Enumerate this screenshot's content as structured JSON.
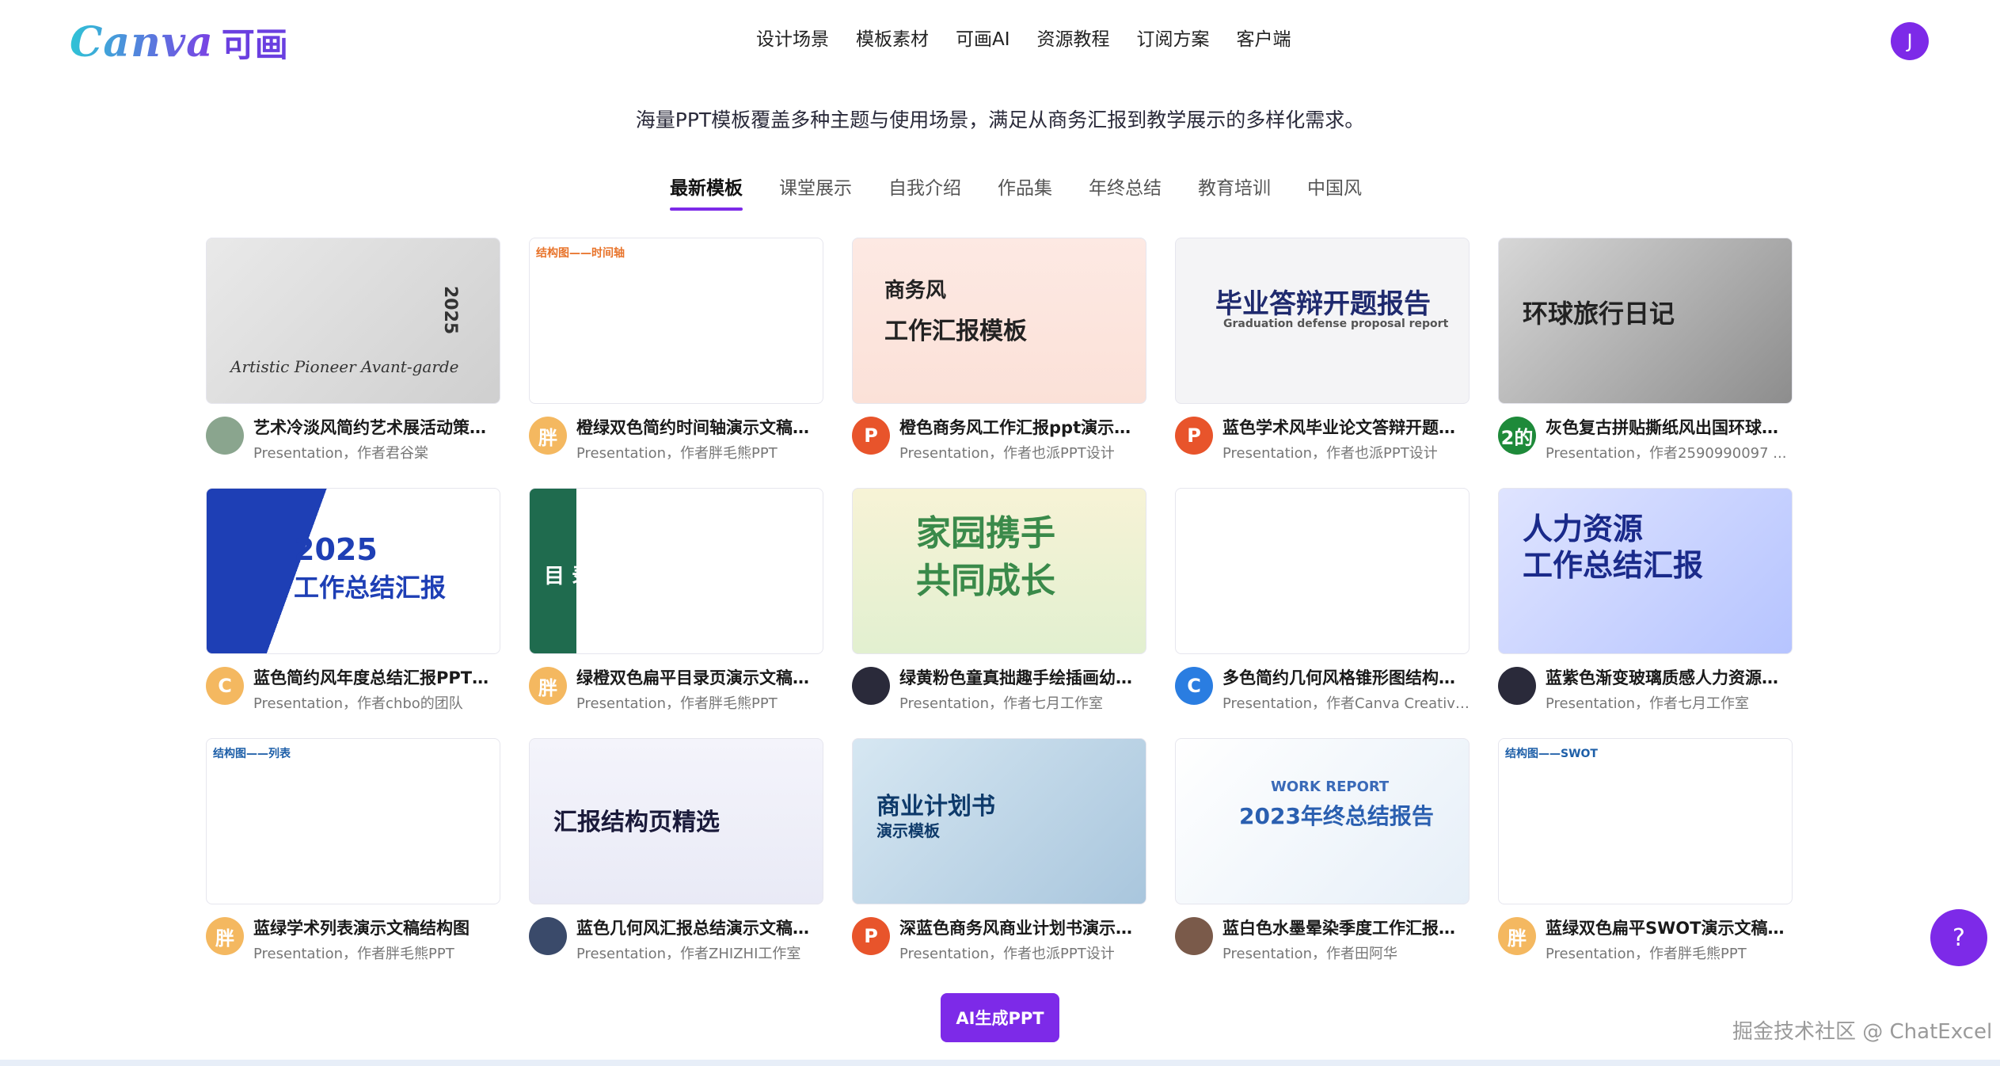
{
  "brand": {
    "word": "Canva",
    "cn": "可画"
  },
  "nav": [
    "设计场景",
    "模板素材",
    "可画AI",
    "资源教程",
    "订阅方案",
    "客户端"
  ],
  "user_initial": "J",
  "subtitle": "海量PPT模板覆盖多种主题与使用场景，满足从商务汇报到教学展示的多样化需求。",
  "tabs": [
    "最新模板",
    "课堂展示",
    "自我介绍",
    "作品集",
    "年终总结",
    "教育培训",
    "中国风"
  ],
  "active_tab": 0,
  "cards": [
    {
      "title": "艺术冷淡风简约艺术展活动策划...",
      "author": "Presentation，作者君谷棠",
      "av": "",
      "avbg": "#8aa58e",
      "thumb": {
        "bg": "linear-gradient(135deg,#e9e9e9,#cfcfcf)",
        "t1": "Artistic Pioneer  Avant-garde",
        "t1c": "#333",
        "t2": "2025",
        "t2c": "#333"
      }
    },
    {
      "title": "橙绿双色简约时间轴演示文稿结...",
      "author": "Presentation，作者胖毛熊PPT",
      "av": "胖",
      "avbg": "#f4b860",
      "thumb": {
        "bg": "#ffffff",
        "t1": "结构图——时间轴",
        "t1c": "#e8742b",
        "t2": "",
        "t2c": "#2a9d8f"
      }
    },
    {
      "title": "橙色商务风工作汇报ppt演示文稿",
      "author": "Presentation，作者也派PPT设计",
      "av": "P",
      "avbg": "#e8542b",
      "thumb": {
        "bg": "linear-gradient(180deg,#fde9e3,#fbe1d8)",
        "t1": "商务风",
        "t1c": "#222",
        "t2": "工作汇报模板",
        "t2c": "#222"
      }
    },
    {
      "title": "蓝色学术风毕业论文答辩开题报...",
      "author": "Presentation，作者也派PPT设计",
      "av": "P",
      "avbg": "#e8542b",
      "thumb": {
        "bg": "#f4f4f6",
        "t1": "毕业答辩开题报告",
        "t1c": "#1f2a6e",
        "t2": "Graduation defense proposal report",
        "t2c": "#555"
      }
    },
    {
      "title": "灰色复古拼贴撕纸风出国环球旅...",
      "author": "Presentation，作者2590990097 ...",
      "av": "2的",
      "avbg": "#1e8a3a",
      "thumb": {
        "bg": "linear-gradient(135deg,#d7d7d7,#8d8d8d)",
        "t1": "环球旅行日记",
        "t1c": "#222",
        "t2": "",
        "t2c": "#222"
      }
    },
    {
      "title": "蓝色简约风年度总结汇报PPT演...",
      "author": "Presentation，作者chbo的团队",
      "av": "C",
      "avbg": "#f4b860",
      "thumb": {
        "bg": "linear-gradient(110deg,#1e3fb5 0 34%,#ffffff 34%)",
        "t1": "2025",
        "t1c": "#1e3fb5",
        "t2": "工作总结汇报",
        "t2c": "#1e3fb5"
      }
    },
    {
      "title": "绿橙双色扁平目录页演示文稿结...",
      "author": "Presentation，作者胖毛熊PPT",
      "av": "胖",
      "avbg": "#f4b860",
      "thumb": {
        "bg": "linear-gradient(90deg,#1f6b4e 0 16%,#ffffff 16%)",
        "t1": "目 录",
        "t1c": "#ffffff",
        "t2": "",
        "t2c": "#e8942b"
      }
    },
    {
      "title": "绿黄粉色童真拙趣手绘插画幼儿...",
      "author": "Presentation，作者七月工作室",
      "av": "",
      "avbg": "#2a2a3a",
      "thumb": {
        "bg": "linear-gradient(180deg,#f7f3d6,#e2f0d0)",
        "t1": "家园携手",
        "t1c": "#3a8a4a",
        "t2": "共同成长",
        "t2c": "#3a8a4a"
      }
    },
    {
      "title": "多色简约几何风格锥形图结构图...",
      "author": "Presentation，作者Canva Creative...",
      "av": "C",
      "avbg": "#2a7de1",
      "thumb": {
        "bg": "#ffffff",
        "t1": "",
        "t1c": "#7b5be4",
        "t2": "",
        "t2c": "#7b5be4"
      }
    },
    {
      "title": "蓝紫色渐变玻璃质感人力资源工...",
      "author": "Presentation，作者七月工作室",
      "av": "",
      "avbg": "#2a2a3a",
      "thumb": {
        "bg": "linear-gradient(135deg,#dfe4ff,#b6c4ff)",
        "t1": "人力资源",
        "t1c": "#1a2a8a",
        "t2": "工作总结汇报",
        "t2c": "#1a2a8a"
      }
    },
    {
      "title": "蓝绿学术列表演示文稿结构图",
      "author": "Presentation，作者胖毛熊PPT",
      "av": "胖",
      "avbg": "#f4b860",
      "thumb": {
        "bg": "#ffffff",
        "t1": "结构图——列表",
        "t1c": "#1e5fa8",
        "t2": "",
        "t2c": "#2a9d8f"
      }
    },
    {
      "title": "蓝色几何风汇报总结演示文稿结...",
      "author": "Presentation，作者ZHIZHI工作室",
      "av": "",
      "avbg": "#3a4a6a",
      "thumb": {
        "bg": "linear-gradient(180deg,#f4f4fb,#e9eaf6)",
        "t1": "汇报结构页精选",
        "t1c": "#1a1a3a",
        "t2": "",
        "t2c": "#3d3fd8"
      }
    },
    {
      "title": "深蓝色商务风商业计划书演示文...",
      "author": "Presentation，作者也派PPT设计",
      "av": "P",
      "avbg": "#e8542b",
      "thumb": {
        "bg": "linear-gradient(135deg,#d6e7f2,#a9c6dd)",
        "t1": "商业计划书",
        "t1c": "#0e3a6a",
        "t2": "演示模板",
        "t2c": "#0e3a6a"
      }
    },
    {
      "title": "蓝白色水墨晕染季度工作汇报年...",
      "author": "Presentation，作者田阿华",
      "av": "",
      "avbg": "#7a5a4a",
      "thumb": {
        "bg": "linear-gradient(135deg,#ffffff,#e6eff8)",
        "t1": "WORK REPORT",
        "t1c": "#3a6ab8",
        "t2": "2023年终总结报告",
        "t2c": "#2a5fb0"
      }
    },
    {
      "title": "蓝绿双色扁平SWOT演示文稿结...",
      "author": "Presentation，作者胖毛熊PPT",
      "av": "胖",
      "avbg": "#f4b860",
      "thumb": {
        "bg": "#ffffff",
        "t1": "结构图——SWOT",
        "t1c": "#1e5fa8",
        "t2": "",
        "t2c": "#2a9d8f"
      }
    }
  ],
  "ai_button": "AI生成PPT",
  "help_icon": "?",
  "watermark": "掘金技术社区 @ ChatExcel"
}
